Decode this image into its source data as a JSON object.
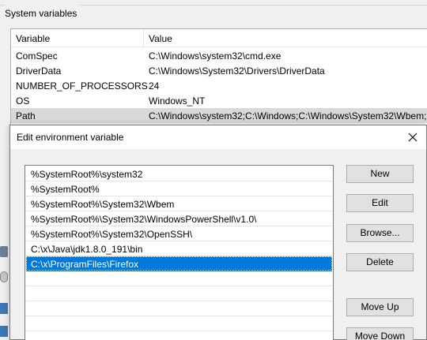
{
  "system_variables": {
    "group_title": "System variables",
    "columns": {
      "variable": "Variable",
      "value": "Value"
    },
    "rows": [
      {
        "name": "ComSpec",
        "value": "C:\\Windows\\system32\\cmd.exe"
      },
      {
        "name": "DriverData",
        "value": "C:\\Windows\\System32\\Drivers\\DriverData"
      },
      {
        "name": "NUMBER_OF_PROCESSORS",
        "value": "24"
      },
      {
        "name": "OS",
        "value": "Windows_NT"
      },
      {
        "name": "Path",
        "value": "C:\\Windows\\system32;C:\\Windows;C:\\Windows\\System32\\Wbem;"
      }
    ]
  },
  "dialog": {
    "title": "Edit environment variable",
    "close_icon": "close-icon",
    "entries": [
      "%SystemRoot%\\system32",
      "%SystemRoot%",
      "%SystemRoot%\\System32\\Wbem",
      "%SystemRoot%\\System32\\WindowsPowerShell\\v1.0\\",
      "%SystemRoot%\\System32\\OpenSSH\\",
      "C:\\x\\Java\\jdk1.8.0_191\\bin",
      "C:\\x\\ProgramFiles\\Firefox"
    ],
    "selected_entry": "C:\\x\\ProgramFiles\\Firefox",
    "buttons": {
      "new": "New",
      "edit": "Edit",
      "browse": "Browse...",
      "delete": "Delete",
      "move_up": "Move Up",
      "move_down": "Move Down"
    }
  },
  "colors": {
    "selection": "#0078d7",
    "window_bg": "#f0f0f0",
    "button_bg": "#e1e1e1",
    "button_border": "#adadad"
  }
}
